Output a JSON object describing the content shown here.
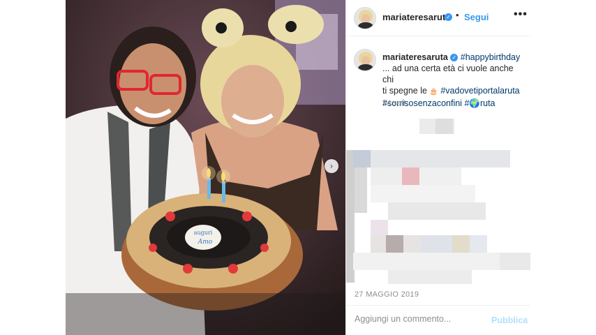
{
  "post": {
    "username": "mariateresaruta",
    "verified_mark": "✓",
    "separator": "•",
    "follow_label": "Segui",
    "more_label": "•••",
    "next_label": "›"
  },
  "caption": {
    "username": "mariateresaruta",
    "hashtag_1": "#happybirthday",
    "line_1": "... ad una certa età ci vuole anche chi",
    "line_2_prefix": "ti spegne le",
    "cake_emoji": "🎂",
    "hashtag_2": "#vadovetiportalaruta",
    "hashtag_3": "#sorrisosenzaconfini",
    "hashtag_4": "#🌍ruta",
    "time_ago": "74 sett."
  },
  "footer": {
    "date": "27 MAGGIO 2019",
    "comment_placeholder": "Aggiungi un commento...",
    "publish_label": "Pubblica"
  },
  "photo": {
    "cake_sign_line_1": "auguri",
    "cake_sign_line_2": "Amo"
  },
  "colors": {
    "accent_blue": "#3897f0",
    "publish_disabled": "#b2dffc",
    "hashtag": "#00376b",
    "muted_text": "#8e8e8e"
  },
  "icons": [
    "verified-badge-icon",
    "more-options-icon",
    "next-arrow-icon"
  ]
}
